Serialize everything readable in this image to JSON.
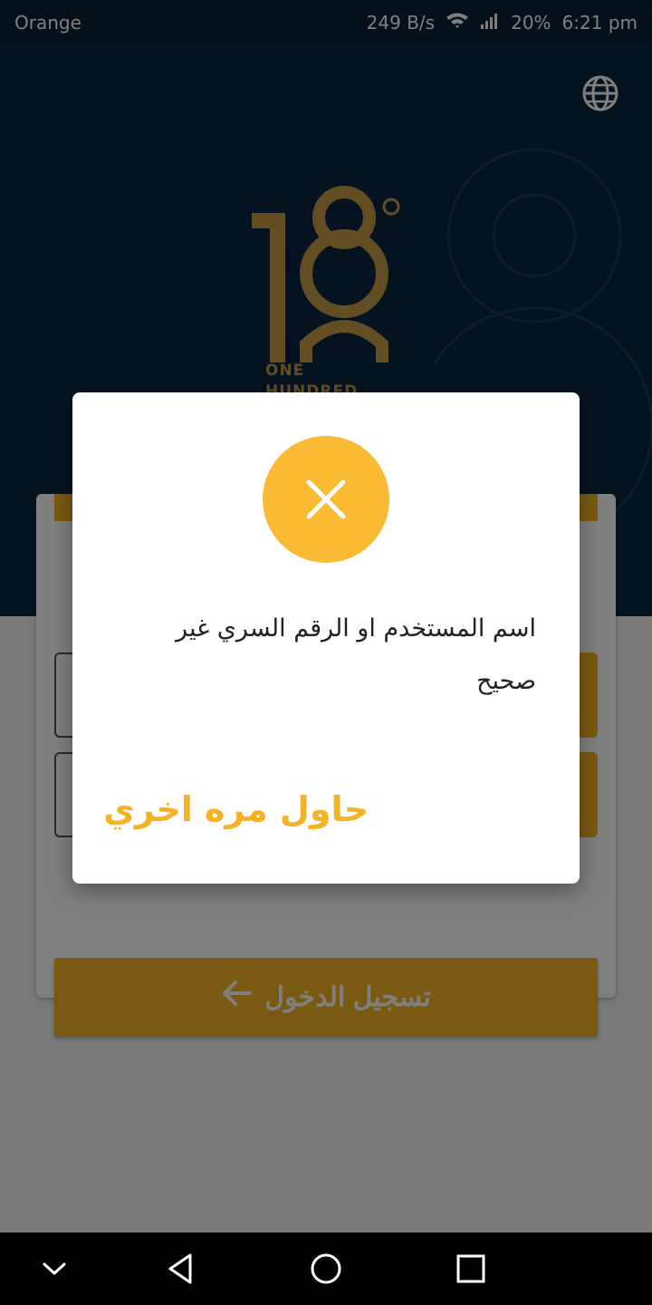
{
  "status_bar": {
    "carrier": "Orange",
    "network_speed": "249 B/s",
    "battery": "20%",
    "time": "6:21 pm"
  },
  "header": {
    "language_icon": "globe-icon"
  },
  "logo": {
    "line1": "ONE",
    "line2": "HUNDRED",
    "accent_color": "#c79a44"
  },
  "login": {
    "button_label": "تسجيل الدخول",
    "button_icon": "arrow-left-icon",
    "accent_color": "#f5b224"
  },
  "dialog": {
    "icon": "close-icon",
    "icon_color": "#fbba34",
    "message": "اسم المستخدم او الرقم السري غير صحيح",
    "retry_label": "حاول مره اخري"
  },
  "nav_bar": {
    "items": [
      "chevron-down-icon",
      "back-triangle-icon",
      "home-circle-icon",
      "recents-square-icon"
    ]
  }
}
